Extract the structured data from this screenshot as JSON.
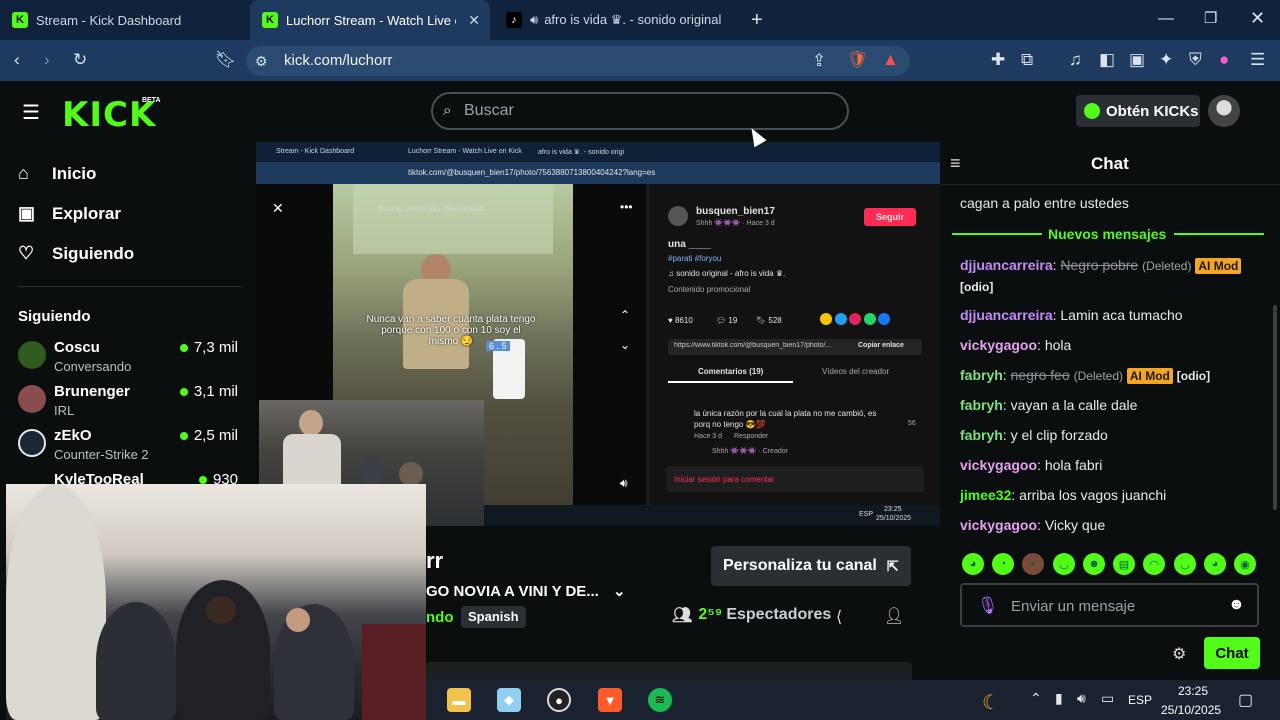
{
  "browser": {
    "tabs": [
      {
        "label": "Stream - Kick Dashboard",
        "icon": "kick-icon",
        "active": false
      },
      {
        "label": "Luchorr Stream - Watch Live on K",
        "icon": "kick-icon",
        "active": true
      },
      {
        "label": "afro is vida ♛. - sonido original",
        "icon": "tiktok-icon",
        "active": false
      }
    ],
    "url": "kick.com/luchorr",
    "new_tab": "+",
    "brave_badge": "3"
  },
  "kick": {
    "logo": "KICK",
    "beta": "BETA",
    "search_placeholder": "Buscar",
    "get_kicks": "Obtén KICKs",
    "brand_color": "#53fc18"
  },
  "sidebar": {
    "nav": [
      {
        "label": "Inicio",
        "icon": "home-icon"
      },
      {
        "label": "Explorar",
        "icon": "explore-icon"
      },
      {
        "label": "Siguiendo",
        "icon": "heart-icon"
      }
    ],
    "following_title": "Siguiendo",
    "channels": [
      {
        "name": "Coscu",
        "category": "Conversando",
        "viewers": "7,3 mil"
      },
      {
        "name": "Brunenger",
        "category": "IRL",
        "viewers": "3,1 mil"
      },
      {
        "name": "zEkO",
        "category": "Counter-Strike 2",
        "viewers": "2,5 mil"
      },
      {
        "name": "KyleTooReal",
        "category": "",
        "viewers": "930"
      }
    ]
  },
  "player": {
    "inner_tabs": [
      "Stream - Kick Dashboard",
      "Luchorr Stream - Watch Live on Kick",
      "afro is vida ♛. - sonido origi"
    ],
    "inner_url": "tiktok.com/@busquen_bien17/photo/7563880713800404242?lang=es",
    "inner_search": "Buscar contenido relacionado",
    "caption": "Nunca van a saber cuánta plata tengo porque con 100 o con 10 soy el mismo 😏",
    "caption_extra": "6 . 5",
    "tiktok": {
      "username": "busquen_bien17",
      "subline": "Shhh 👾👾👾 · Hace 3 d",
      "follow": "Seguir",
      "desc": "una ____",
      "tags": "#parati #foryou",
      "sound": "♫ sonido original - afro is vida ♛.",
      "promo": "Contenido promocional",
      "likes": "8610",
      "comments": "19",
      "saves": "528",
      "link": "https://www.tiktok.com/@busquen_bien17/photo/...",
      "copy": "Copiar enlace",
      "tab_comments": "Comentarios (19)",
      "tab_videos": "Vídeos del creador",
      "comment_text": "la única razón por la cual la plata no me cambió, es porq no tengo 😎💯",
      "comment_meta": "Hace 3 d",
      "comment_reply": "Responder",
      "comment_likes": "56",
      "creator_line": "Shhh 👾👾👾 · Creador",
      "login": "Iniciar sesión para comentar"
    },
    "inner_clock_time": "23:25",
    "inner_clock_date": "25/10/2025",
    "inner_lang": "ESP"
  },
  "stream": {
    "streamer_fragment": "rr",
    "title_fragment": "GO NOVIA A VINI Y DE...",
    "status_fragment": "ndo",
    "language": "Spanish",
    "customize": "Personaliza tu canal",
    "viewers_count": "2⁵⁹",
    "viewers_label": "Espectadores"
  },
  "chat": {
    "title": "Chat",
    "partial_top": "cagan a palo entre ustedes",
    "new_messages": "Nuevos mensajes",
    "messages": [
      {
        "user": "djjuancarreira",
        "color": "#c58cf7",
        "deleted_text": "Negro pobre",
        "deleted_note": "(Deleted)",
        "badge": "AI Mod",
        "tag": "[odio]"
      },
      {
        "user": "djjuancarreira",
        "color": "#c58cf7",
        "text": "Lamin aca tumacho"
      },
      {
        "user": "vickygagoo",
        "color": "#e8a0f0",
        "text": "hola"
      },
      {
        "user": "fabryh",
        "color": "#7ee07a",
        "deleted_text": "negro feo",
        "deleted_note": "(Deleted)",
        "badge": "AI Mod",
        "tag": "[odio]"
      },
      {
        "user": "fabryh",
        "color": "#7ee07a",
        "text": "vayan a la calle dale"
      },
      {
        "user": "fabryh",
        "color": "#7ee07a",
        "text": "y el clip forzado"
      },
      {
        "user": "vickygagoo",
        "color": "#e8a0f0",
        "text": "hola fabri"
      },
      {
        "user": "jimee32",
        "color": "#53fc18",
        "text": "arriba los vagos juanchi"
      },
      {
        "user": "vickygagoo",
        "color": "#e8a0f0",
        "text": "Vicky que"
      }
    ],
    "input_placeholder": "Enviar un mensaje",
    "send_button": "Chat"
  },
  "taskbar": {
    "time": "23:25",
    "date": "25/10/2025",
    "lang": "ESP"
  }
}
